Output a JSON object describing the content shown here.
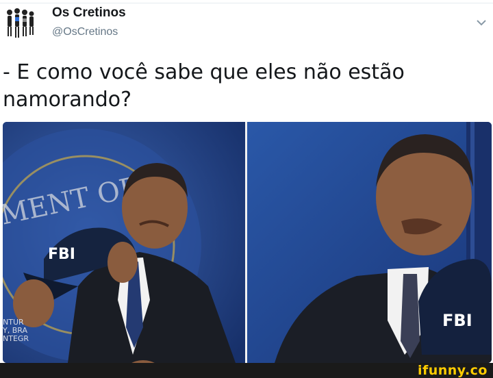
{
  "tweet": {
    "author_name": "Os Cretinos",
    "author_handle": "@OsCretinos",
    "text": "- E como você sabe que eles não estão namorando?",
    "menu_icon": "chevron-down-icon",
    "avatar_icon": "group-avatar"
  },
  "media": {
    "left_photo": {
      "wall_text": "MENT OF",
      "cap_text": "FBI",
      "side_text": [
        "NTUR",
        "Y, BRA",
        "NTEGR"
      ]
    },
    "right_photo": {
      "cap_text": "FBI"
    }
  },
  "watermark": {
    "text": "ifunny.co"
  },
  "colors": {
    "name": "#14171a",
    "handle": "#657786",
    "background_blue": "#1d3d78",
    "watermark": "#ffcc00"
  }
}
